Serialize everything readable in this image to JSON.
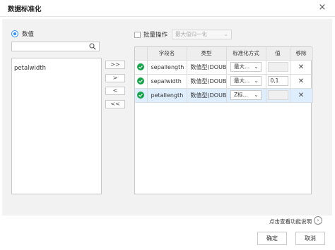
{
  "dialog": {
    "title": "数据标准化",
    "close_glyph": "×"
  },
  "left": {
    "radio_label": "数值",
    "search_placeholder": "",
    "fields": [
      "petalwidth"
    ],
    "move_buttons": [
      ">>",
      ">",
      "<",
      "<<"
    ]
  },
  "right": {
    "batch_label": "批量操作",
    "batch_select_value": "最大值归一化",
    "columns": [
      "",
      "字段名",
      "类型",
      "标准化方式",
      "值",
      "移除"
    ],
    "rows": [
      {
        "status_icon": "check-circle-icon",
        "field": "sepallength",
        "type": "数值型(DOUBLE)",
        "method": "最大...",
        "value": "",
        "selected": false
      },
      {
        "status_icon": "check-circle-icon",
        "field": "sepalwidth",
        "type": "数值型(DOUBLE)",
        "method": "最大...",
        "value": "0,1",
        "selected": false
      },
      {
        "status_icon": "check-circle-icon",
        "field": "petallength",
        "type": "数值型(DOUBLE)",
        "method": "Z标...",
        "value": "",
        "selected": true
      }
    ],
    "remove_glyph": "✕"
  },
  "footer": {
    "help_link": "点击查看功能说明",
    "help_arrow": "›",
    "confirm": "确定",
    "cancel": "取消"
  },
  "colors": {
    "accent": "#2b8cff",
    "ok_green": "#16a34a",
    "selected_row": "#dfeefe"
  }
}
